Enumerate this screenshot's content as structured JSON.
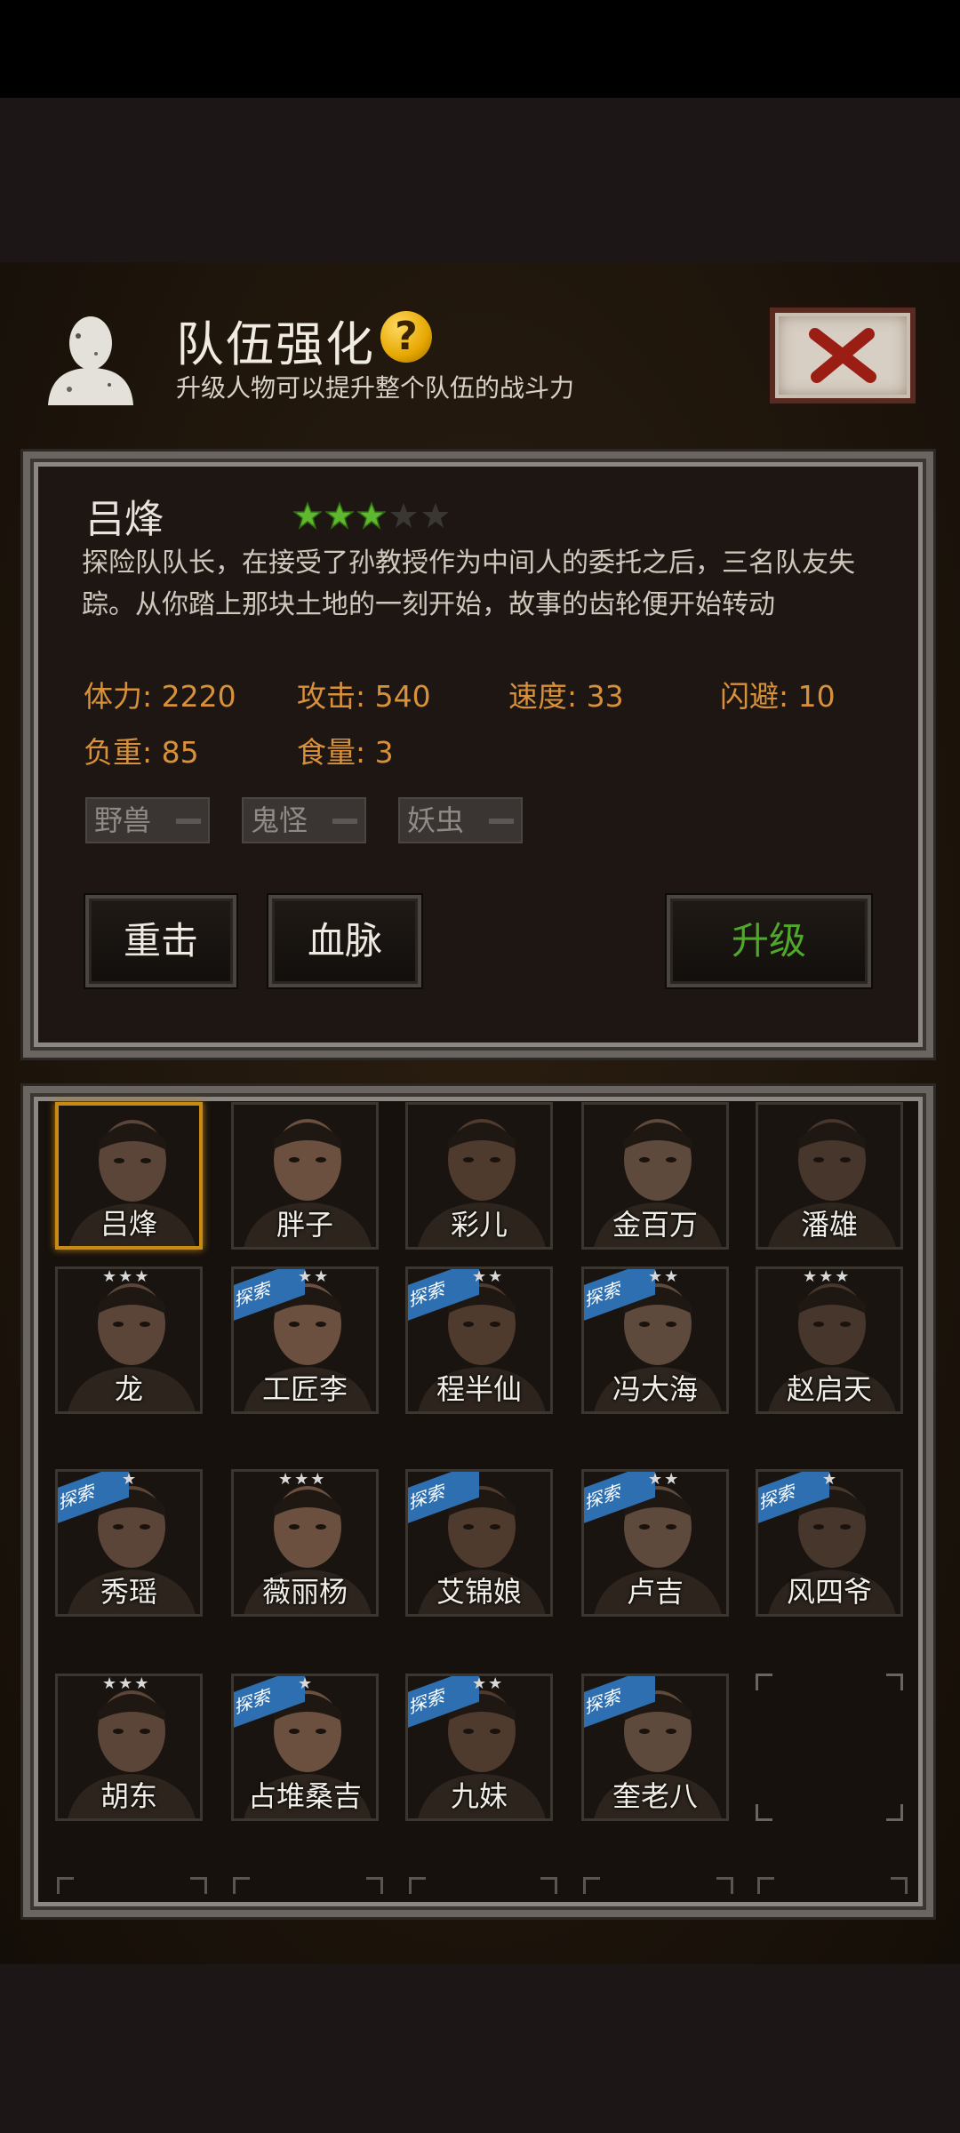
{
  "header": {
    "title": "队伍强化",
    "help_icon": "question-icon",
    "subtitle": "升级人物可以提升整个队伍的战斗力",
    "close_icon": "close-x-icon"
  },
  "character": {
    "name": "吕烽",
    "stars": 3,
    "max_stars": 5,
    "description": "探险队队长，在接受了孙教授作为中间人的委托之后，三名队友失踪。从你踏上那块土地的一刻开始，故事的齿轮便开始转动",
    "stats": {
      "hp": "体力: 2220",
      "attack": "攻击: 540",
      "speed": "速度: 33",
      "dodge": "闪避: 10",
      "load": "负重: 85",
      "food": "食量: 3"
    },
    "tags": [
      "野兽",
      "鬼怪",
      "妖虫"
    ]
  },
  "buttons": {
    "heavy_strike": "重击",
    "bloodline": "血脉",
    "upgrade": "升级"
  },
  "explore_badge": "探索",
  "roster": [
    {
      "name": "吕烽",
      "stars": 0,
      "explore": false,
      "selected": true
    },
    {
      "name": "胖子",
      "stars": 0,
      "explore": false,
      "selected": false
    },
    {
      "name": "彩儿",
      "stars": 0,
      "explore": false,
      "selected": false
    },
    {
      "name": "金百万",
      "stars": 0,
      "explore": false,
      "selected": false
    },
    {
      "name": "潘雄",
      "stars": 0,
      "explore": false,
      "selected": false
    },
    {
      "name": "龙",
      "stars": 3,
      "explore": false,
      "selected": false
    },
    {
      "name": "工匠李",
      "stars": 2,
      "explore": true,
      "selected": false
    },
    {
      "name": "程半仙",
      "stars": 2,
      "explore": true,
      "selected": false
    },
    {
      "name": "冯大海",
      "stars": 2,
      "explore": true,
      "selected": false
    },
    {
      "name": "赵启天",
      "stars": 3,
      "explore": false,
      "selected": false
    },
    {
      "name": "秀瑶",
      "stars": 1,
      "explore": true,
      "selected": false
    },
    {
      "name": "薇丽杨",
      "stars": 3,
      "explore": false,
      "selected": false
    },
    {
      "name": "艾锦娘",
      "stars": 0,
      "explore": true,
      "selected": false
    },
    {
      "name": "卢吉",
      "stars": 2,
      "explore": true,
      "selected": false
    },
    {
      "name": "风四爷",
      "stars": 1,
      "explore": true,
      "selected": false
    },
    {
      "name": "胡东",
      "stars": 3,
      "explore": false,
      "selected": false
    },
    {
      "name": "占堆桑吉",
      "stars": 1,
      "explore": true,
      "selected": false
    },
    {
      "name": "九妹",
      "stars": 2,
      "explore": true,
      "selected": false
    },
    {
      "name": "奎老八",
      "stars": 0,
      "explore": true,
      "selected": false
    }
  ]
}
